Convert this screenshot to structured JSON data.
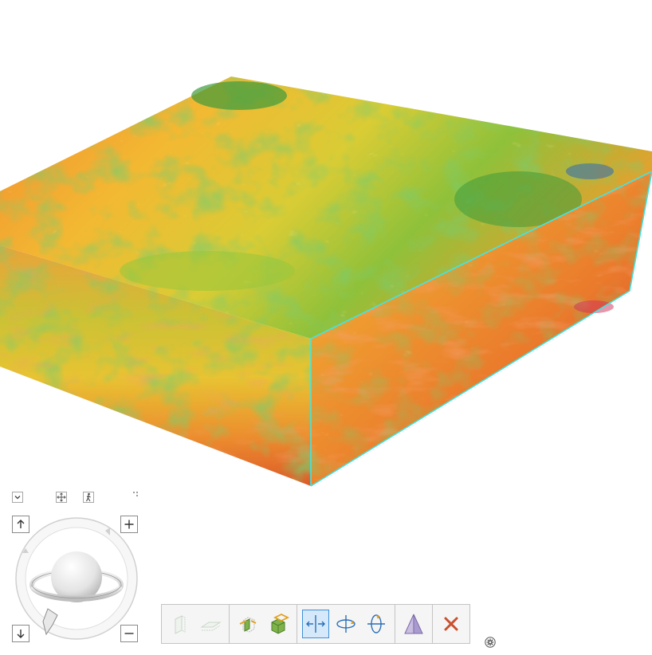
{
  "colors": {
    "selection_outline": "#3fe6e6",
    "volume_low": "#2f9a3a",
    "volume_mid": "#e8d234",
    "volume_high": "#e8542a",
    "toolbar_active": "#3c8fd8",
    "close_red": "#c8502e"
  },
  "view_controls": {
    "collapse_icon": "chevron-down-icon",
    "fit_icon": "full-extent-icon",
    "walk_icon": "walk-mode-icon",
    "grip_icon": "grip-icon"
  },
  "navigator": {
    "up_icon": "arrow-up-icon",
    "down_icon": "arrow-down-icon",
    "zoom_in_icon": "plus-icon",
    "zoom_out_icon": "minus-icon",
    "globe_icon": "planet-ring-icon",
    "rotate_icon": "tilt-handle-icon"
  },
  "toolbar": {
    "groups": [
      [
        "vertical-slice-icon",
        "horizontal-slice-icon"
      ],
      [
        "inline-section-icon",
        "cube-section-icon"
      ],
      [
        "move-section-icon",
        "rotate-section-icon",
        "tilt-section-icon"
      ],
      [
        "flip-section-icon"
      ],
      [
        "close-icon"
      ]
    ],
    "active": "move-section-icon",
    "settings_icon": "gear-icon"
  }
}
